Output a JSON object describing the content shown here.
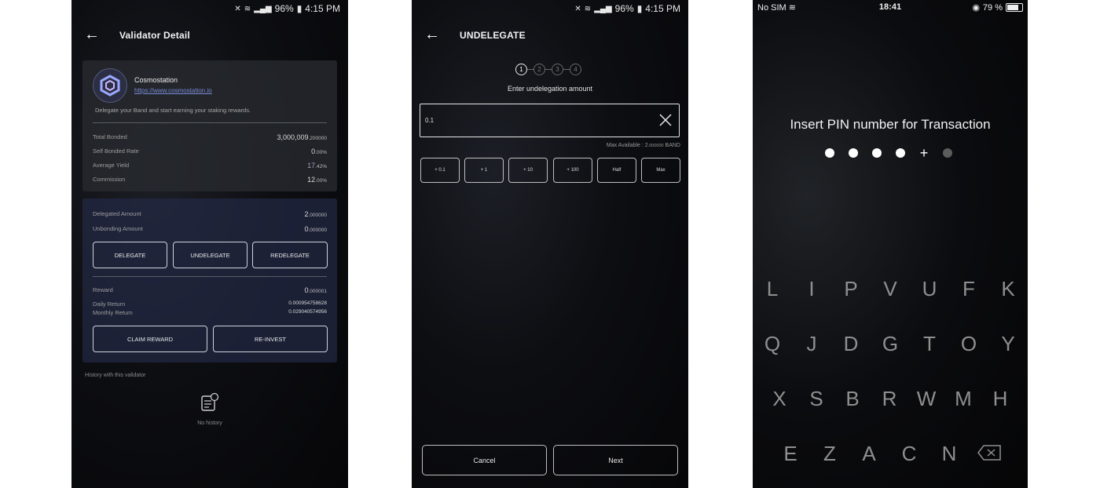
{
  "panel1": {
    "status": {
      "volume": "🔇",
      "wifi": "WiFi",
      "signal": "signal",
      "battery_pct": "96%",
      "time": "4:15 PM"
    },
    "title": "Validator Detail",
    "validator": {
      "name": "Cosmostation",
      "link": "https://www.cosmostation.io",
      "description": "Delegate your Band and start earning your staking rewards.",
      "stats": [
        {
          "label": "Total Bonded",
          "value": "3,000,009",
          "frac": ".200000"
        },
        {
          "label": "Self Bonded Rate",
          "value": "0",
          "frac": ".00%"
        },
        {
          "label": "Average Yield",
          "value": "17",
          "frac": ".42%"
        },
        {
          "label": "Commission",
          "value": "12",
          "frac": ".00%"
        }
      ]
    },
    "delegation": {
      "delegated_label": "Delegated Amount",
      "delegated_value": "2",
      "delegated_frac": ".000000",
      "unbonding_label": "Unbonding Amount",
      "unbonding_value": "0",
      "unbonding_frac": ".000000",
      "buttons": [
        "DELEGATE",
        "UNDELEGATE",
        "REDELEGATE"
      ],
      "reward_label": "Reward",
      "reward_value": "0",
      "reward_frac": ".000001",
      "daily_label": "Daily Return",
      "daily_value": "0.000954758628",
      "monthly_label": "Monthly Return",
      "monthly_value": "0.029040574956",
      "claim_label": "CLAIM REWARD",
      "reinvest_label": "RE-INVEST"
    },
    "history_label": "History with this validator",
    "no_history": "No history"
  },
  "panel2": {
    "status": {
      "battery_pct": "96%",
      "time": "4:15 PM"
    },
    "title": "UNDELEGATE",
    "steps": [
      "1",
      "2",
      "3",
      "4"
    ],
    "active_step": 1,
    "instruction": "Enter undelegation amount",
    "amount_value": "0.1",
    "max_available_label": "Max Available : ",
    "max_available_value": "2",
    "max_available_frac": ".000000",
    "max_available_unit": " BAND",
    "quick_buttons": [
      "+ 0.1",
      "+ 1",
      "+ 10",
      "+ 100",
      "Half",
      "Max"
    ],
    "cancel_label": "Cancel",
    "next_label": "Next"
  },
  "panel3": {
    "status": {
      "carrier": "No SIM",
      "time": "18:41",
      "battery_pct": "79 %"
    },
    "pin_title": "Insert PIN number for Transaction",
    "keys_row1": [
      "L",
      "I",
      "P",
      "V",
      "U",
      "F",
      "K"
    ],
    "keys_row2": [
      "Q",
      "J",
      "D",
      "G",
      "T",
      "O",
      "Y"
    ],
    "keys_row3": [
      "X",
      "S",
      "B",
      "R",
      "W",
      "M",
      "H"
    ],
    "keys_row4": [
      "E",
      "Z",
      "A",
      "C",
      "N"
    ]
  }
}
